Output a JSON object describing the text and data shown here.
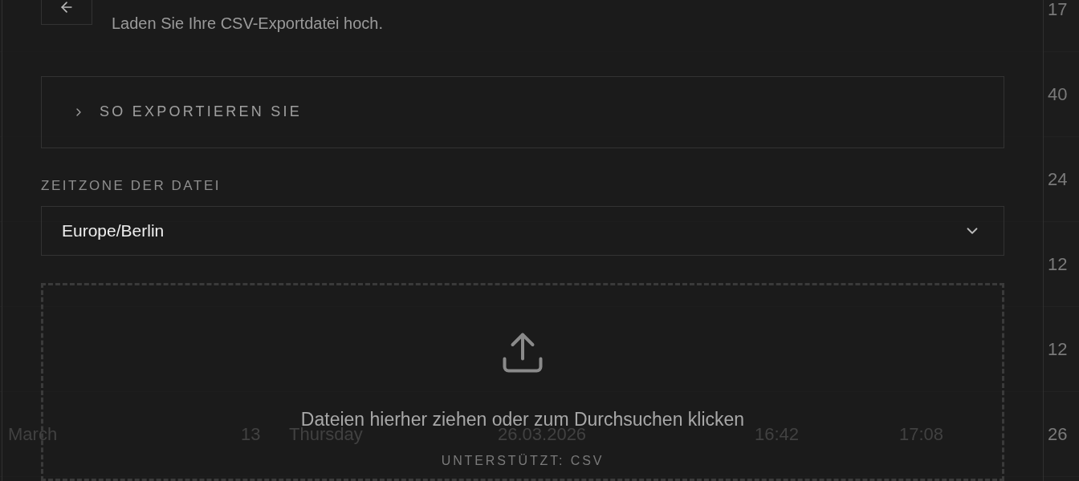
{
  "background_table": {
    "rows": [
      {
        "duration": "17"
      },
      {
        "duration": "40"
      },
      {
        "duration": "24"
      },
      {
        "duration": "12"
      },
      {
        "duration": "12"
      },
      {
        "month": "March",
        "day": "13",
        "weekday": "Thursday",
        "date": "26.03.2026",
        "start": "16:42",
        "end": "17:08",
        "duration": "26"
      }
    ]
  },
  "dialog": {
    "subtitle": "Laden Sie Ihre CSV-Exportdatei hoch.",
    "help_section": {
      "label": "SO EXPORTIEREN SIE",
      "expanded": false
    },
    "timezone": {
      "label": "ZEITZONE DER DATEI",
      "value": "Europe/Berlin"
    },
    "dropzone": {
      "prompt": "Dateien hierher ziehen oder zum Durchsuchen klicken",
      "supported": "UNTERSTÜTZT: CSV"
    }
  }
}
